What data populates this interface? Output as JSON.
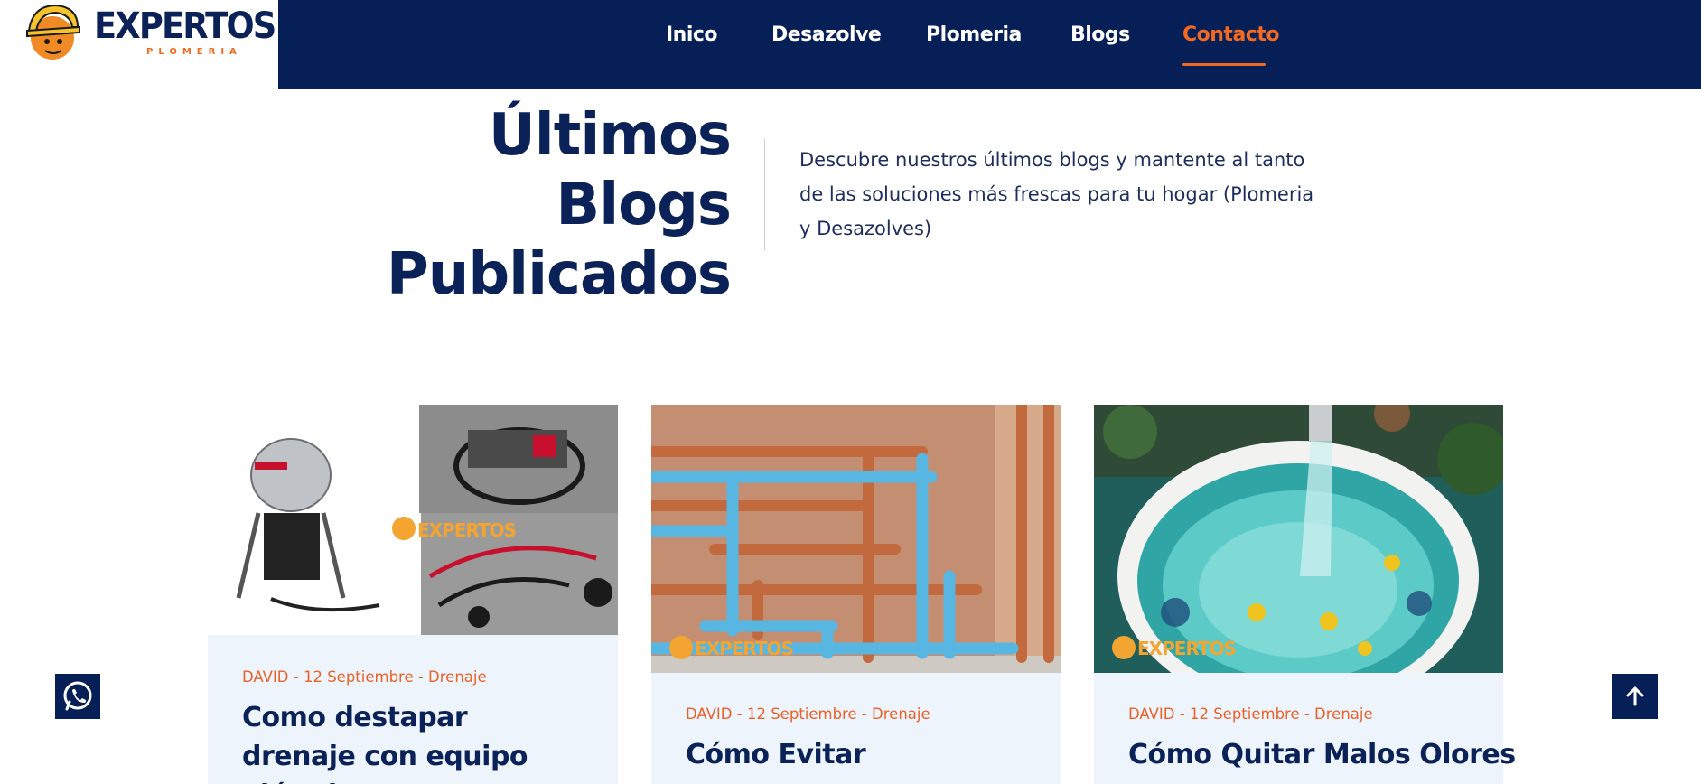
{
  "brand": {
    "name": "EXPERTOS",
    "tagline": "PLOMERIA"
  },
  "nav": {
    "items": [
      {
        "label": "Inico"
      },
      {
        "label": "Desazolve"
      },
      {
        "label": "Plomeria"
      },
      {
        "label": "Blogs"
      },
      {
        "label": "Contacto",
        "active": true
      }
    ]
  },
  "hero": {
    "title_lines": [
      "Últimos",
      "Blogs",
      "Publicados"
    ],
    "description": "Descubre nuestros últimos blogs y mantente al tanto de las soluciones más frescas para tu hogar (Plomeria y Desazolves)"
  },
  "posts": [
    {
      "meta": "DAVID - 12 Septiembre - Drenaje",
      "title": "Como destapar drenaje con equipo eléctrico",
      "image": "drain-cleaning-machines",
      "watermark": "EXPERTOS"
    },
    {
      "meta": "DAVID - 12 Septiembre - Drenaje",
      "title": "Cómo Evitar",
      "image": "copper-and-blue-pipes",
      "watermark": "EXPERTOS"
    },
    {
      "meta": "DAVID - 12 Septiembre - Drenaje",
      "title": "Cómo Quitar Malos Olores",
      "image": "water-filled-basin",
      "watermark": "EXPERTOS"
    }
  ],
  "floating": {
    "whatsapp_icon": "whatsapp-icon",
    "top_icon": "arrow-up-icon"
  },
  "colors": {
    "navy": "#071f57",
    "accent": "#f26a21",
    "card_bg": "#eef4fb"
  }
}
